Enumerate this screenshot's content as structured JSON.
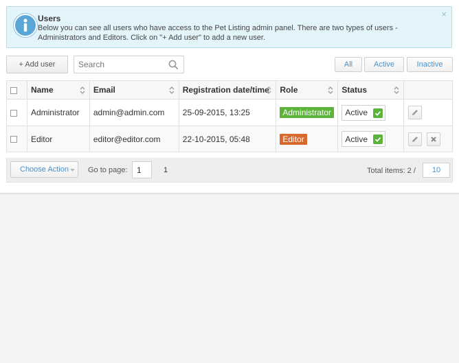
{
  "alert": {
    "title": "Users",
    "text": "Below you can see all users who have access to the Pet Listing admin panel. There are two types of users - Administrators and Editors. Click on \"+ Add user\" to add a new user.",
    "close": "×"
  },
  "toolbar": {
    "add_user": "+ Add user",
    "search_placeholder": "Search",
    "filters": [
      "All",
      "Active",
      "Inactive"
    ]
  },
  "table": {
    "columns": [
      "Name",
      "Email",
      "Registration date/time",
      "Role",
      "Status"
    ],
    "rows": [
      {
        "name": "Administrator",
        "email": "admin@admin.com",
        "registered": "25-09-2015, 13:25",
        "role": "Administrator",
        "role_color": "#5bb33a",
        "status": "Active"
      },
      {
        "name": "Editor",
        "email": "editor@editor.com",
        "registered": "22-10-2015, 05:48",
        "role": "Editor",
        "role_color": "#d9682d",
        "status": "Active"
      }
    ]
  },
  "footer": {
    "choose_action": "Choose Action",
    "goto_label": "Go to page:",
    "page_value": "1",
    "page_count": "1",
    "total_label": "Total items: 2 /",
    "per_page": "10"
  },
  "colors": {
    "accent": "#4a90c9",
    "alert_bg": "#e3f4fb",
    "success": "#5bb33a",
    "editor": "#d9682d"
  }
}
